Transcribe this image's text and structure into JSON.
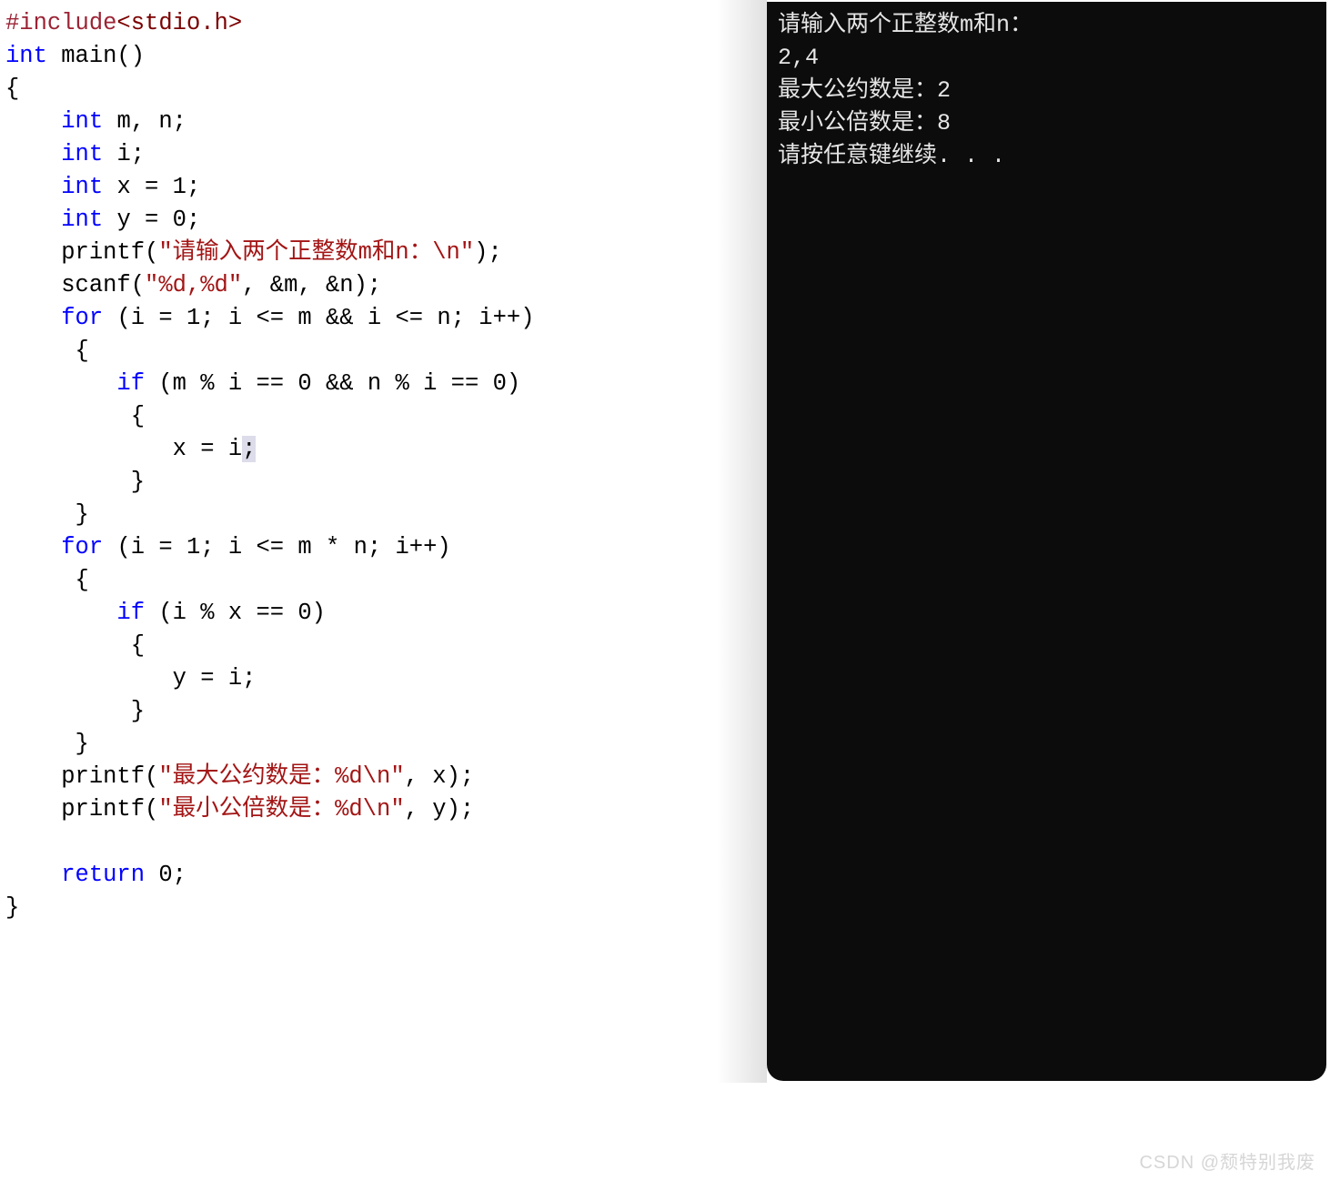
{
  "code": {
    "l1_hash": "#include",
    "l1_lt": "<",
    "l1_hdr": "stdio.h",
    "l1_gt": ">",
    "l2_kw": "int",
    "l2_rest": " main()",
    "l3": "{",
    "l4_pre": "    ",
    "l4_kw": "int",
    "l4_rest": " m, n;",
    "l5_pre": "    ",
    "l5_kw": "int",
    "l5_rest": " i;",
    "l6_pre": "    ",
    "l6_kw": "int",
    "l6_rest": " x = 1;",
    "l7_pre": "    ",
    "l7_kw": "int",
    "l7_rest": " y = 0;",
    "l8_pre": "    printf(",
    "l8_str": "\"请输入两个正整数m和n：\\n\"",
    "l8_end": ");",
    "l9_pre": "    scanf(",
    "l9_str": "\"%d,%d\"",
    "l9_end": ", &m, &n);",
    "l10_pre": "    ",
    "l10_kw": "for",
    "l10_rest": " (i = 1; i <= m && i <= n; i++)",
    "l11": "     {",
    "l12_pre": "        ",
    "l12_kw": "if",
    "l12_rest": " (m % i == 0 && n % i == 0)",
    "l13": "         {",
    "l14_pre": "            x = i",
    "l14_hl": ";",
    "l15": "         }",
    "l16": "     }",
    "l17_pre": "    ",
    "l17_kw": "for",
    "l17_rest": " (i = 1; i <= m * n; i++)",
    "l18": "     {",
    "l19_pre": "        ",
    "l19_kw": "if",
    "l19_rest": " (i % x == 0)",
    "l20": "         {",
    "l21": "            y = i;",
    "l22": "         }",
    "l23": "     }",
    "l24_pre": "    printf(",
    "l24_str": "\"最大公约数是：%d\\n\"",
    "l24_end": ", x);",
    "l25_pre": "    printf(",
    "l25_str": "\"最小公倍数是：%d\\n\"",
    "l25_end": ", y);",
    "l26": "",
    "l27_pre": "    ",
    "l27_kw": "return",
    "l27_rest": " 0;",
    "l28": "}"
  },
  "console": {
    "line1": "请输入两个正整数m和n：",
    "line2": "2,4",
    "line3": "最大公约数是：2",
    "line4": "最小公倍数是：8",
    "line5": "请按任意键继续. . ."
  },
  "watermark": "CSDN @颓特别我废"
}
